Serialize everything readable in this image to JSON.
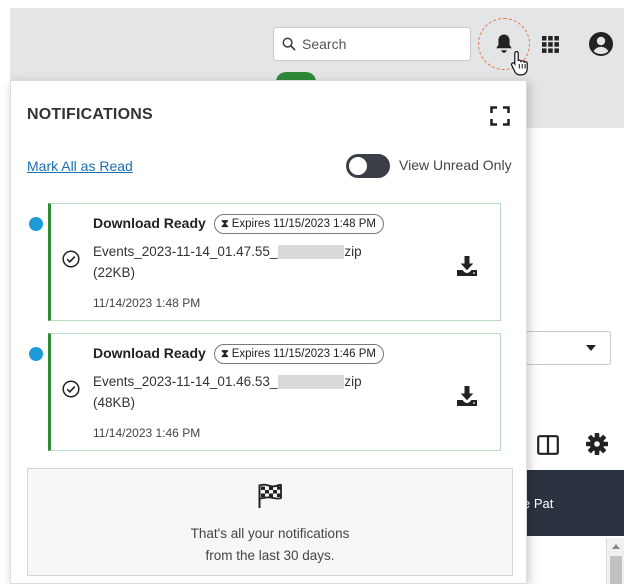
{
  "header": {
    "search_placeholder": "Search"
  },
  "panel": {
    "title": "NOTIFICATIONS",
    "mark_all_label": "Mark All as Read",
    "view_unread_label": "View Unread Only",
    "view_unread_on": false
  },
  "notifications": [
    {
      "title": "Download Ready",
      "expires": "Expires 11/15/2023 1:48 PM",
      "file_prefix": "Events_2023-11-14_01.47.55_",
      "file_suffix": "zip",
      "size": "(22KB)",
      "date": "11/14/2023 1:48 PM",
      "unread": true
    },
    {
      "title": "Download Ready",
      "expires": "Expires 11/15/2023 1:46 PM",
      "file_prefix": "Events_2023-11-14_01.46.53_",
      "file_suffix": "zip",
      "size": "(48KB)",
      "date": "11/14/2023 1:46 PM",
      "unread": true
    }
  ],
  "footer": {
    "line1": "That's all your notifications",
    "line2": "from the last 30 days."
  },
  "background": {
    "column_header_partial": "e Pat"
  },
  "colors": {
    "accent_green": "#2e8b3a",
    "unread_dot": "#1e9bd7",
    "link": "#1a6fb0",
    "dark_header": "#2b3340"
  }
}
